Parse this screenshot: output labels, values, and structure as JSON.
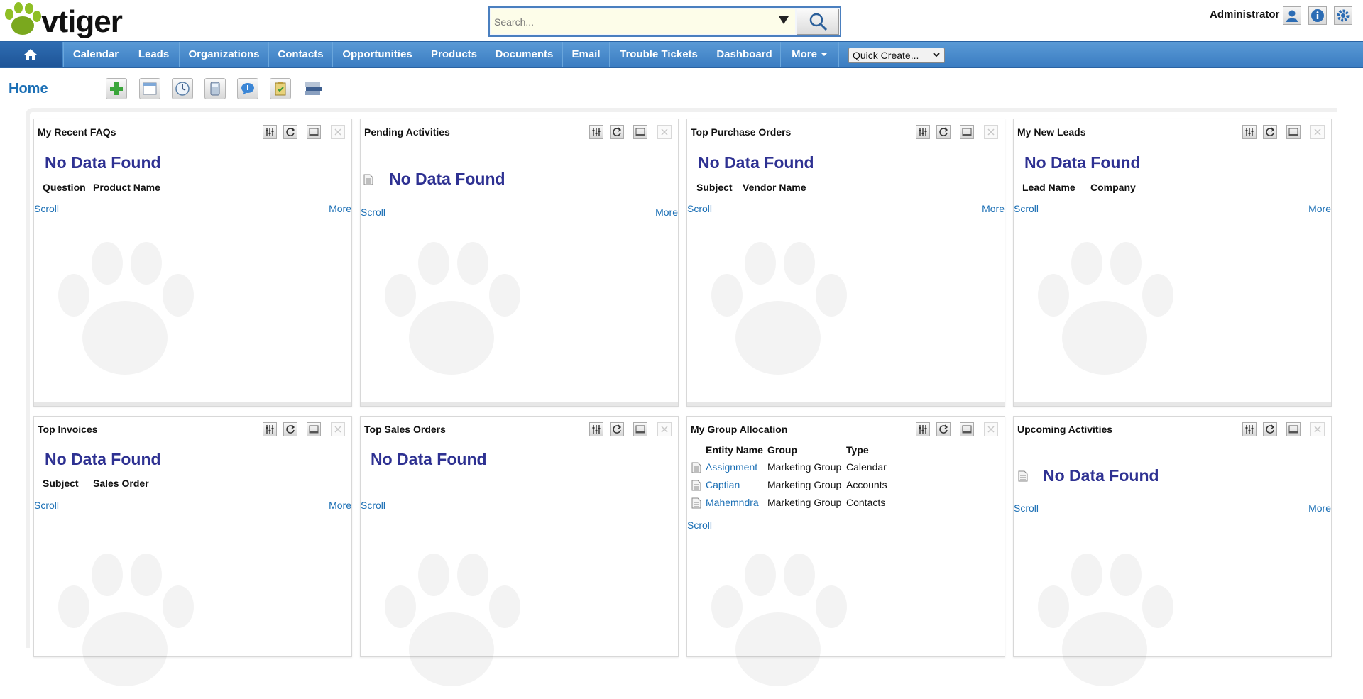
{
  "app": {
    "brand": "vtiger",
    "accent": "#1b6fb5",
    "nav_color": "#3a7cc1"
  },
  "header": {
    "search_placeholder": "Search...",
    "user": "Administrator",
    "icons": [
      "my-preferences-icon",
      "help-info-icon",
      "settings-gear-icon"
    ]
  },
  "nav": {
    "home_icon": "home-icon",
    "items": [
      "Calendar",
      "Leads",
      "Organizations",
      "Contacts",
      "Opportunities",
      "Products",
      "Documents",
      "Email",
      "Trouble Tickets",
      "Dashboard",
      "More"
    ],
    "quick_create": "Quick Create..."
  },
  "page": {
    "title": "Home",
    "toolbar_icons": [
      "add-widget-icon",
      "layout-icon",
      "clock-icon",
      "calculator-icon",
      "chat-icon",
      "notebook-icon",
      "tag-cloud-icon"
    ]
  },
  "widgets": [
    {
      "title": "My Recent FAQs",
      "no_data": "No Data Found",
      "columns": [
        "Question",
        "Product Name"
      ],
      "scroll": "Scroll",
      "more": "More"
    },
    {
      "title": "Pending Activities",
      "no_data": "No Data Found",
      "scroll": "Scroll",
      "more": "More"
    },
    {
      "title": "Top Purchase Orders",
      "no_data": "No Data Found",
      "columns": [
        "Subject",
        "Vendor Name"
      ],
      "scroll": "Scroll",
      "more": "More"
    },
    {
      "title": "My New Leads",
      "no_data": "No Data Found",
      "columns": [
        "Lead Name",
        "Company"
      ],
      "scroll": "Scroll",
      "more": "More"
    },
    {
      "title": "Top Invoices",
      "no_data": "No Data Found",
      "columns": [
        "Subject",
        "Sales Order"
      ],
      "scroll": "Scroll",
      "more": "More"
    },
    {
      "title": "Top Sales Orders",
      "no_data": "No Data Found",
      "scroll": "Scroll"
    },
    {
      "title": "My Group Allocation",
      "columns": [
        "Entity Name",
        "Group",
        "Type"
      ],
      "rows": [
        {
          "entity": "Assignment",
          "group": "Marketing Group",
          "type": "Calendar"
        },
        {
          "entity": "Captian",
          "group": "Marketing Group",
          "type": "Accounts"
        },
        {
          "entity": "Mahemndra",
          "group": "Marketing Group",
          "type": "Contacts"
        }
      ],
      "scroll": "Scroll"
    },
    {
      "title": "Upcoming Activities",
      "no_data": "No Data Found",
      "scroll": "Scroll",
      "more": "More"
    }
  ]
}
